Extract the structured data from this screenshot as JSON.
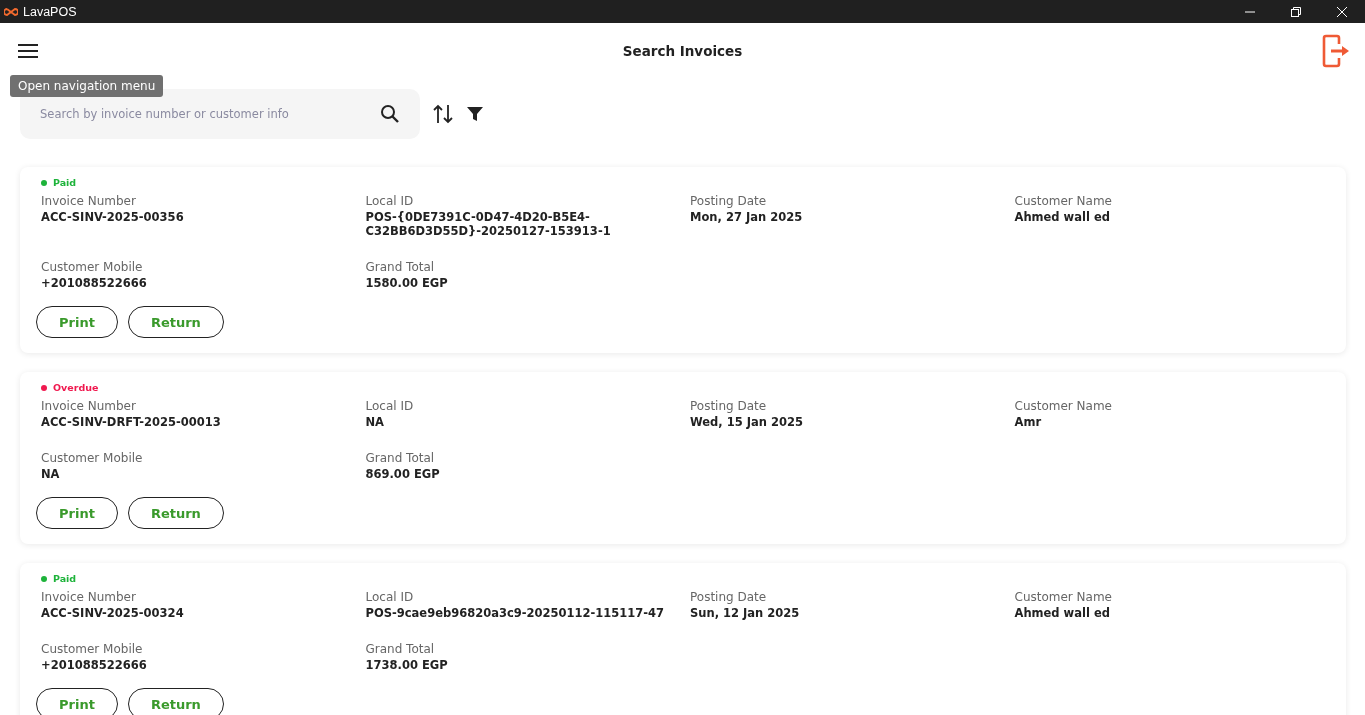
{
  "window": {
    "title": "LavaPOS"
  },
  "header": {
    "title": "Search Invoices",
    "tooltip": "Open navigation menu"
  },
  "search": {
    "placeholder": "Search by invoice number or customer info"
  },
  "invoices": [
    {
      "status": "Paid",
      "color": "#1db33a",
      "fields": [
        {
          "label": "Invoice Number",
          "value": "ACC-SINV-2025-00356"
        },
        {
          "label": "Local ID",
          "value": "POS-{0DE7391C-0D47-4D20-B5E4-C32BB6D3D55D}-20250127-153913-1"
        },
        {
          "label": "Posting Date",
          "value": "Mon, 27 Jan 2025"
        },
        {
          "label": "Customer Name",
          "value": "Ahmed wall ed"
        },
        {
          "label": "Customer Mobile",
          "value": "+201088522666"
        },
        {
          "label": "Grand Total",
          "value": "1580.00 EGP"
        }
      ],
      "buttons": [
        "Print",
        "Return"
      ]
    },
    {
      "status": "Overdue",
      "color": "#f0194f",
      "fields": [
        {
          "label": "Invoice Number",
          "value": "ACC-SINV-DRFT-2025-00013"
        },
        {
          "label": "Local ID",
          "value": "NA"
        },
        {
          "label": "Posting Date",
          "value": "Wed, 15 Jan 2025"
        },
        {
          "label": "Customer Name",
          "value": "Amr"
        },
        {
          "label": "Customer Mobile",
          "value": "NA"
        },
        {
          "label": "Grand Total",
          "value": "869.00 EGP"
        }
      ],
      "buttons": [
        "Print",
        "Return"
      ]
    },
    {
      "status": "Paid",
      "color": "#1db33a",
      "fields": [
        {
          "label": "Invoice Number",
          "value": "ACC-SINV-2025-00324"
        },
        {
          "label": "Local ID",
          "value": "POS-9cae9eb96820a3c9-20250112-115117-47"
        },
        {
          "label": "Posting Date",
          "value": "Sun, 12 Jan 2025"
        },
        {
          "label": "Customer Name",
          "value": "Ahmed wall ed"
        },
        {
          "label": "Customer Mobile",
          "value": "+201088522666"
        },
        {
          "label": "Grand Total",
          "value": "1738.00 EGP"
        }
      ],
      "buttons": [
        "Print",
        "Return"
      ]
    }
  ]
}
